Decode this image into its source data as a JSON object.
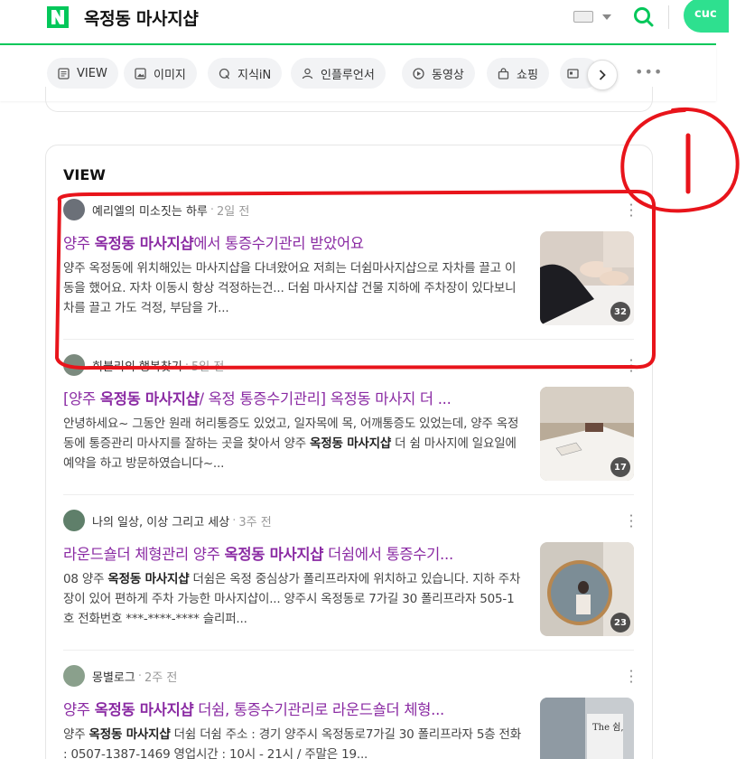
{
  "header": {
    "logo_letter": "N",
    "query": "옥정동 마사지샵",
    "avatar_text": "cuc"
  },
  "tabs": [
    {
      "label": "VIEW",
      "icon": "document-icon"
    },
    {
      "label": "이미지",
      "icon": "image-icon"
    },
    {
      "label": "지식iN",
      "icon": "q-icon"
    },
    {
      "label": "인플루언서",
      "icon": "person-icon"
    },
    {
      "label": "동영상",
      "icon": "play-icon"
    },
    {
      "label": "쇼핑",
      "icon": "bag-icon"
    }
  ],
  "section": {
    "title": "VIEW"
  },
  "posts": [
    {
      "author": "예리엘의 미소짓는 하루",
      "time": "2일 전",
      "title_pre": "양주 ",
      "title_bold": "옥정동 마사지샵",
      "title_post": "에서 통증수기관리 받았어요",
      "desc": "양주 옥정동에 위치해있는 마사지샵을 다녀왔어요 저희는 더쉼마사지샵으로 자차를 끌고 이동을 했어요. 자차 이동시 항상 걱정하는건... 더쉼 마사지샵 건물 지하에 주차장이 있다보니 차를 끌고 가도 걱정, 부담을 가...",
      "image_count": "32"
    },
    {
      "author": "희블리의 행복찾기",
      "time": "5일 전",
      "title_pre": "[양주 ",
      "title_bold": "옥정동 마사지샵",
      "title_post": "/ 옥정 통증수기관리] 옥정동 마사지 더 ...",
      "desc_pre": "안녕하세요~ 그동안 원래 허리통증도 있었고, 일자목에 목, 어깨통증도 있었는데, 양주 옥정동에 통증관리 마사지를 잘하는 곳을 찾아서 양주 ",
      "desc_bold": "옥정동 마사지샵",
      "desc_post": " 더 쉼 마사지에 일요일에 예약을 하고 방문하였습니다~...",
      "image_count": "17"
    },
    {
      "author": "나의 일상, 이상 그리고 세상",
      "time": "3주 전",
      "title_pre": "라운드숄더 체형관리 양주 ",
      "title_bold": "옥정동 마사지샵",
      "title_post": " 더쉼에서 통증수기...",
      "desc_pre": "08 양주 ",
      "desc_bold": "옥정동 마사지샵",
      "desc_post": " 더쉼은 옥정 중심상가 폴리프라자에 위치하고 있습니다. 지하 주차장이 있어 편하게 주차 가능한 마사지샵이... 양주시 옥정동로 7가길 30 폴리프라자 505-1호 전화번호 ***-****-**** 슬리퍼...",
      "image_count": "23"
    },
    {
      "author": "몽별로그",
      "time": "2주 전",
      "title_pre": "양주 ",
      "title_bold": "옥정동 마사지샵",
      "title_post": " 더쉼, 통증수기관리로 라운드숄더 체형...",
      "desc_pre": "양주 ",
      "desc_bold": "옥정동 마사지샵",
      "desc_post": " 더쉼 더쉼 주소 : 경기 양주시 옥정동로7가길 30 폴리프라자 5층 전화 : 0507-1387-1469 영업시간 : 10시 - 21시 / 주말은 19...",
      "image_count": ""
    }
  ],
  "annotation": {
    "label": "1",
    "color": "#e8141b"
  }
}
